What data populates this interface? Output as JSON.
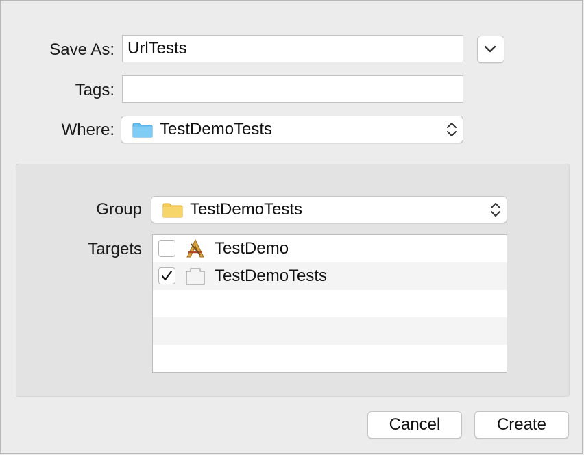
{
  "form": {
    "save_as_label": "Save As:",
    "save_as_value": "UrlTests",
    "tags_label": "Tags:",
    "tags_value": "",
    "where_label": "Where:",
    "where_value": "TestDemoTests"
  },
  "options": {
    "group_label": "Group",
    "group_value": "TestDemoTests",
    "targets_label": "Targets",
    "targets": [
      {
        "name": "TestDemo",
        "checked": false,
        "icon": "xcode-app-icon"
      },
      {
        "name": "TestDemoTests",
        "checked": true,
        "icon": "test-bundle-icon"
      }
    ]
  },
  "buttons": {
    "cancel_label": "Cancel",
    "create_label": "Create"
  },
  "colors": {
    "where_folder": "#6cc3f2",
    "group_folder": "#f3cc58",
    "panel_bg": "#e3e3e3",
    "dialog_bg": "#ececec"
  }
}
